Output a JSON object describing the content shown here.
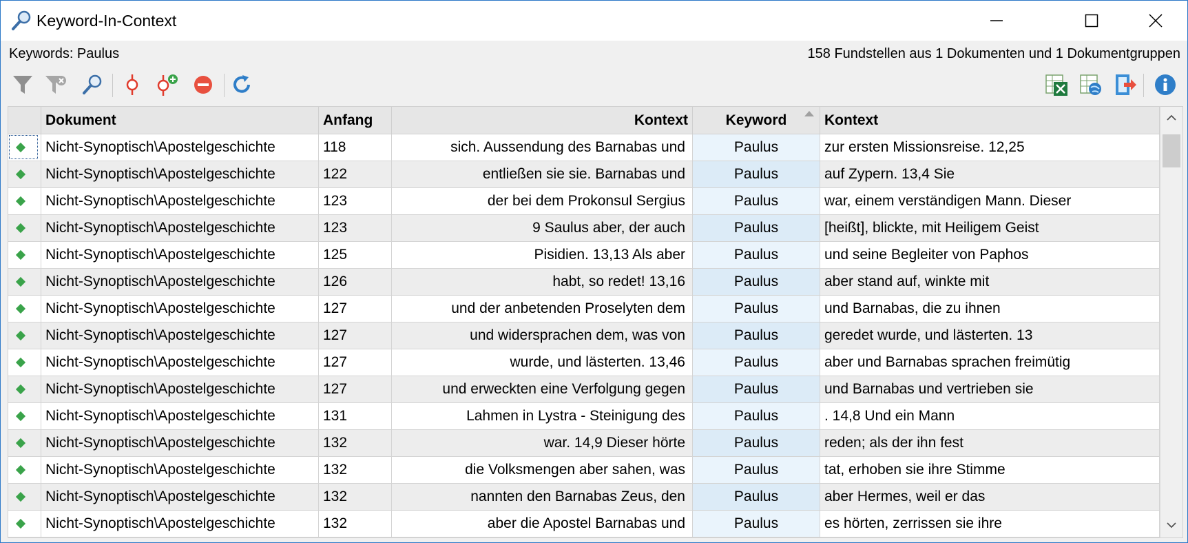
{
  "window": {
    "title": "Keyword-In-Context",
    "icon": "magnifier-icon",
    "controls": [
      "minimize-icon",
      "maximize-icon",
      "close-icon"
    ]
  },
  "info": {
    "keywords_label": "Keywords: Paulus",
    "summary": "158 Fundstellen aus 1 Dokumenten und 1 Dokumentgruppen"
  },
  "toolbar": {
    "left_icons": [
      "filter-icon",
      "clear-filter-icon",
      "search-icon",
      "code-icon",
      "add-code-icon",
      "remove-icon",
      "refresh-icon"
    ],
    "right_icons": [
      "export-excel-icon",
      "export-html-icon",
      "export-icon",
      "info-icon"
    ]
  },
  "colors": {
    "accent": "#2b78c8",
    "diamond": "#3aa34a",
    "keyword_column": "#eaf4fc",
    "code_red": "#e03b2c"
  },
  "table": {
    "headers": {
      "dokument": "Dokument",
      "anfang": "Anfang",
      "kontext_left": "Kontext",
      "keyword": "Keyword",
      "kontext_right": "Kontext"
    },
    "sorted_column": "Keyword",
    "rows": [
      {
        "dokument": "Nicht-Synoptisch\\Apostelgeschichte",
        "anfang": "118",
        "left": "sich.   Aussendung des Barnabas und",
        "keyword": "Paulus",
        "right": " zur ersten Missionsreise.  12,25"
      },
      {
        "dokument": "Nicht-Synoptisch\\Apostelgeschichte",
        "anfang": "122",
        "left": "entließen sie sie.   Barnabas und",
        "keyword": "Paulus",
        "right": "auf Zypern.  13,4 Sie"
      },
      {
        "dokument": "Nicht-Synoptisch\\Apostelgeschichte",
        "anfang": "123",
        "left": "der bei dem Prokonsul Sergius",
        "keyword": "Paulus",
        "right": "war, einem verständigen Mann. Dieser"
      },
      {
        "dokument": "Nicht-Synoptisch\\Apostelgeschichte",
        "anfang": "123",
        "left": "9 Saulus aber, der auch",
        "keyword": "Paulus",
        "right": "[heißt], blickte, mit Heiligem Geist"
      },
      {
        "dokument": "Nicht-Synoptisch\\Apostelgeschichte",
        "anfang": "125",
        "left": "Pisidien.  13,13 Als aber",
        "keyword": "Paulus",
        "right": "und seine Begleiter von Paphos"
      },
      {
        "dokument": "Nicht-Synoptisch\\Apostelgeschichte",
        "anfang": "126",
        "left": "habt, so redet! 13,16",
        "keyword": "Paulus",
        "right": "aber stand auf, winkte mit"
      },
      {
        "dokument": "Nicht-Synoptisch\\Apostelgeschichte",
        "anfang": "127",
        "left": "und der anbetenden Proselyten dem",
        "keyword": "Paulus",
        "right": "und Barnabas, die zu ihnen"
      },
      {
        "dokument": "Nicht-Synoptisch\\Apostelgeschichte",
        "anfang": "127",
        "left": "und widersprachen dem, was von",
        "keyword": "Paulus",
        "right": "geredet wurde, und lästerten. 13"
      },
      {
        "dokument": "Nicht-Synoptisch\\Apostelgeschichte",
        "anfang": "127",
        "left": "wurde, und lästerten. 13,46",
        "keyword": "Paulus",
        "right": "aber und Barnabas sprachen freimütig"
      },
      {
        "dokument": "Nicht-Synoptisch\\Apostelgeschichte",
        "anfang": "127",
        "left": "und erweckten eine Verfolgung gegen",
        "keyword": "Paulus",
        "right": "und Barnabas und vertrieben sie"
      },
      {
        "dokument": "Nicht-Synoptisch\\Apostelgeschichte",
        "anfang": "131",
        "left": "Lahmen in Lystra - Steinigung des",
        "keyword": "Paulus",
        "right": ".  14,8 Und ein Mann"
      },
      {
        "dokument": "Nicht-Synoptisch\\Apostelgeschichte",
        "anfang": "132",
        "left": "war. 14,9 Dieser hörte",
        "keyword": "Paulus",
        "right": "reden; als der ihn fest"
      },
      {
        "dokument": "Nicht-Synoptisch\\Apostelgeschichte",
        "anfang": "132",
        "left": "die Volksmengen aber sahen, was",
        "keyword": "Paulus",
        "right": "tat, erhoben sie ihre Stimme"
      },
      {
        "dokument": "Nicht-Synoptisch\\Apostelgeschichte",
        "anfang": "132",
        "left": "nannten den Barnabas Zeus, den",
        "keyword": "Paulus",
        "right": "aber Hermes, weil er das"
      },
      {
        "dokument": "Nicht-Synoptisch\\Apostelgeschichte",
        "anfang": "132",
        "left": "aber die Apostel Barnabas und",
        "keyword": "Paulus",
        "right": "es hörten, zerrissen sie ihre"
      }
    ]
  }
}
